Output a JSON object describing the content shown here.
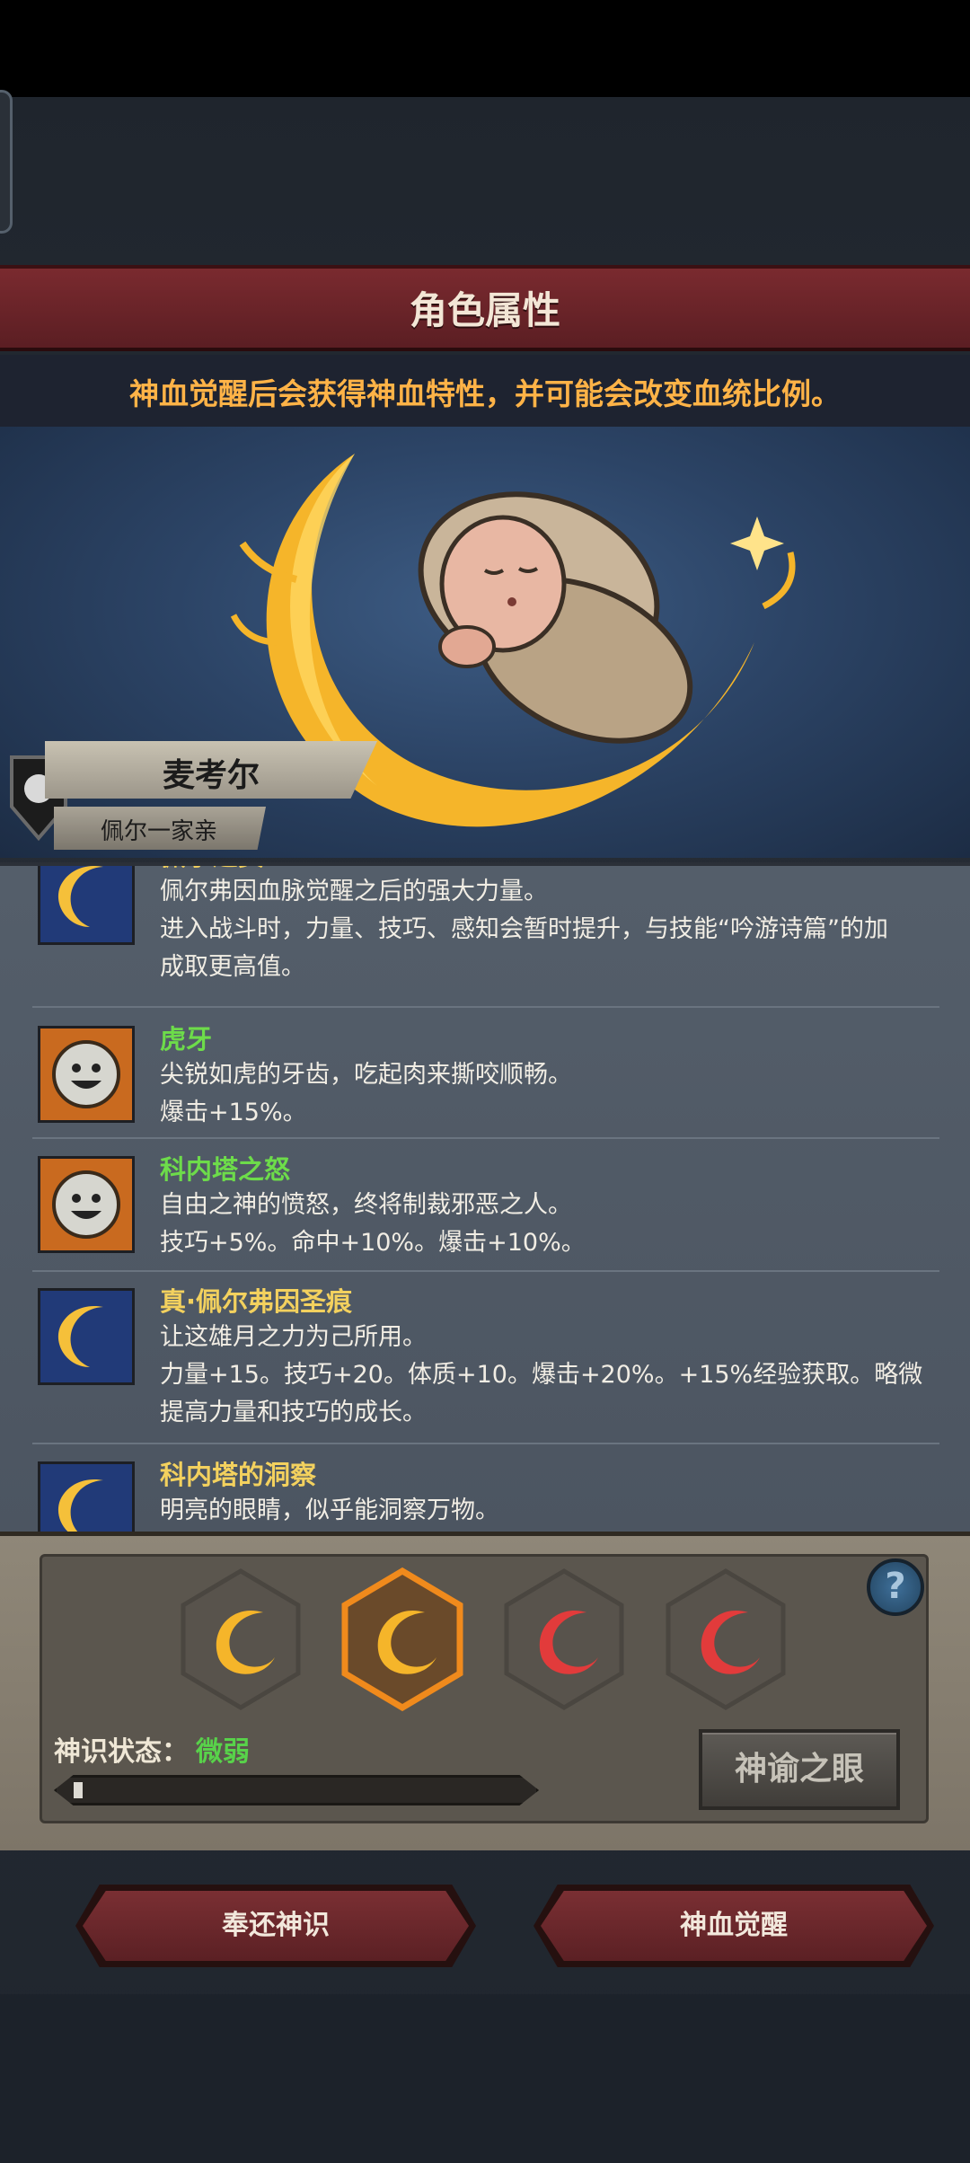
{
  "header": {
    "title": "角色属性",
    "subtitle": "神血觉醒后会获得神血特性，并可能会改变血统比例。"
  },
  "character": {
    "name": "麦考尔",
    "family": "佩尔一家亲"
  },
  "traits": [
    {
      "name": "佩尔之资",
      "name_color": "yellow",
      "icon": "moon-icon",
      "lines": [
        "佩尔弗因血脉觉醒之后的强大力量。",
        "进入战斗时，力量、技巧、感知会暂时提升，与技能“吟游诗篇”的加",
        "成取更高值。"
      ]
    },
    {
      "name": "虎牙",
      "name_color": "green",
      "icon": "smiley-sun-icon",
      "lines": [
        "尖锐如虎的牙齿，吃起肉来撕咬顺畅。",
        "爆击+15%。"
      ]
    },
    {
      "name": "科内塔之怒",
      "name_color": "green",
      "icon": "smiley-sun-icon",
      "lines": [
        "自由之神的愤怒，终将制裁邪恶之人。",
        "技巧+5%。命中+10%。爆击+10%。"
      ]
    },
    {
      "name": "真·佩尔弗因圣痕",
      "name_color": "yellow",
      "icon": "moon-icon",
      "lines": [
        "让这雄月之力为己所用。",
        "力量+15。技巧+20。体质+10。爆击+20%。+15%经验获取。略微",
        "提高力量和技巧的成长。"
      ]
    },
    {
      "name": "科内塔的洞察",
      "name_color": "yellow",
      "icon": "moon-icon",
      "lines": [
        "明亮的眼睛，似乎能洞察万物。"
      ]
    }
  ],
  "divine_sense": {
    "slots": [
      {
        "name": "gold-crescent-slot-1",
        "color": "#f5b52a",
        "selected": false
      },
      {
        "name": "gold-crescent-slot-2",
        "color": "#f5b52a",
        "selected": true
      },
      {
        "name": "red-crescent-slot-1",
        "color": "#e23b3b",
        "selected": false
      },
      {
        "name": "red-crescent-slot-2",
        "color": "#e23b3b",
        "selected": false
      }
    ],
    "status_label": "神识状态：",
    "status_value": "微弱",
    "progress": 0.02,
    "help_label": "?",
    "oracle_button": "神谕之眼"
  },
  "actions": {
    "return_label": "奉还神识",
    "awaken_label": "神血觉醒"
  },
  "colors": {
    "green": "#6ddc4a",
    "yellow": "#f3d15e",
    "orange": "#ffb347"
  }
}
